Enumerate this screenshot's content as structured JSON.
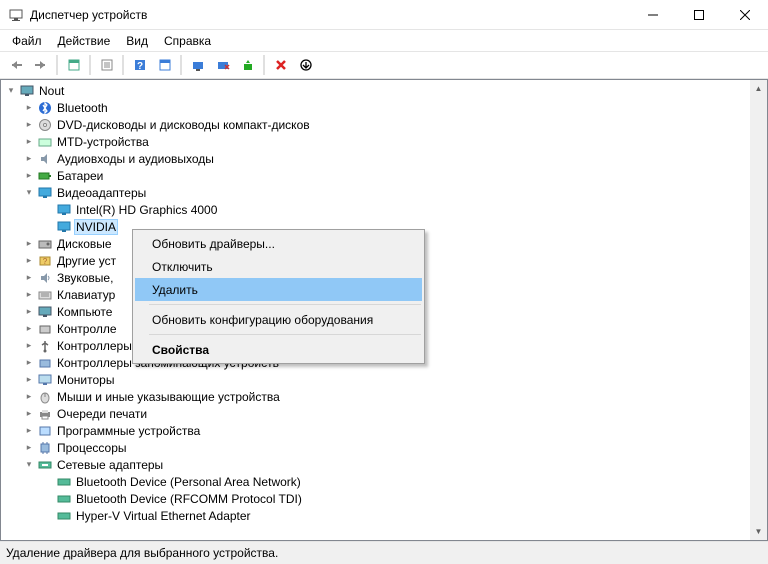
{
  "window": {
    "title": "Диспетчер устройств"
  },
  "menu": {
    "file": "Файл",
    "action": "Действие",
    "view": "Вид",
    "help": "Справка"
  },
  "tree": {
    "root": "Nout",
    "bluetooth": "Bluetooth",
    "dvd": "DVD-дисководы и дисководы компакт-дисков",
    "mtd": "MTD-устройства",
    "audio": "Аудиовходы и аудиовыходы",
    "battery": "Батареи",
    "display": "Видеоадаптеры",
    "display_intel": "Intel(R) HD Graphics 4000",
    "display_nvidia": "NVIDIA",
    "disk": "Дисковые",
    "other": "Другие уст",
    "sound": "Звуковые,",
    "keyboard": "Клавиатур",
    "computer": "Компьюте",
    "controllers_ide": "Контролле",
    "usb": "Контроллеры USB",
    "storage": "Контроллеры запоминающих устройств",
    "monitors": "Мониторы",
    "mice": "Мыши и иные указывающие устройства",
    "printq": "Очереди печати",
    "software": "Программные устройства",
    "cpu": "Процессоры",
    "net": "Сетевые адаптеры",
    "net_btpan": "Bluetooth Device (Personal Area Network)",
    "net_btrfcomm": "Bluetooth Device (RFCOMM Protocol TDI)",
    "net_hyperv": "Hyper-V Virtual Ethernet Adapter"
  },
  "context": {
    "update": "Обновить драйверы...",
    "disable": "Отключить",
    "delete": "Удалить",
    "scan": "Обновить конфигурацию оборудования",
    "props": "Свойства"
  },
  "status": "Удаление драйвера для выбранного устройства."
}
